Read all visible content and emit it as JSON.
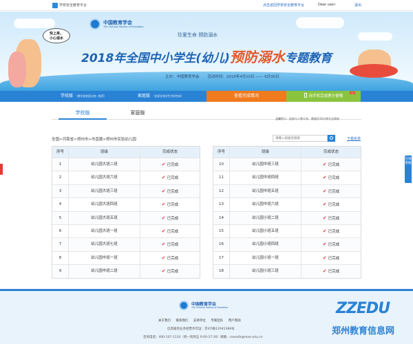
{
  "topbar": {
    "site_name": "学校安全教育平台",
    "login_link": "点击返回学校安全教育平台",
    "user": "Dear user:",
    "logout": "退出"
  },
  "banner": {
    "org_name": "中国教育学会",
    "org_en": "The Chinese Society of Education",
    "slogan": "珍爱生命    预防溺水",
    "headline_pre": "2018年全国中小学生(幼儿)",
    "headline_em": "预防溺水",
    "headline_post": "专题教育",
    "host": "主办：中国教育学会",
    "date": "活动时间：2018年4月10日 —— 6月30日",
    "bubble_line1": "快上来，",
    "bubble_line2": "小心溺水"
  },
  "nav": {
    "school": "学校版",
    "school_sub": "（教学校校园与统一推荐）",
    "family": "家庭版",
    "family_sub": "（由家长和学生共同完成）",
    "view_progress": "查看完成情况",
    "mobile": "用手机完成更方便哦",
    "new_badge": "new"
  },
  "tabs": {
    "school": "学校版",
    "family": "家庭版",
    "tip": "温馨提示：因参与人数众多，数据约30分钟左右刷新"
  },
  "breadcrumb": "全国>河南省>郑州市>市直属>郑州市实验幼儿园",
  "search": {
    "placeholder": "请输入班级名搜索",
    "download": "下载名单"
  },
  "table": {
    "col_no": "序号",
    "col_class": "班级",
    "col_status": "完成状态",
    "left_rows": [
      {
        "no": "1",
        "cls": "幼儿园大班二班",
        "status": "已完成"
      },
      {
        "no": "2",
        "cls": "幼儿园大班六班",
        "status": "已完成"
      },
      {
        "no": "3",
        "cls": "幼儿园大班三班",
        "status": "已完成"
      },
      {
        "no": "4",
        "cls": "幼儿园大班四班",
        "status": "已完成"
      },
      {
        "no": "5",
        "cls": "幼儿园大班五班",
        "status": "已完成"
      },
      {
        "no": "6",
        "cls": "幼儿园大班一班",
        "status": "已完成"
      },
      {
        "no": "7",
        "cls": "幼儿园大班七班",
        "status": "已完成"
      },
      {
        "no": "8",
        "cls": "幼儿园中班一班",
        "status": "已完成"
      },
      {
        "no": "9",
        "cls": "幼儿园中班二班",
        "status": "已完成"
      }
    ],
    "right_rows": [
      {
        "no": "10",
        "cls": "幼儿园中班三班",
        "status": "已完成"
      },
      {
        "no": "11",
        "cls": "幼儿园中班四班",
        "status": "已完成"
      },
      {
        "no": "12",
        "cls": "幼儿园中班五班",
        "status": "已完成"
      },
      {
        "no": "13",
        "cls": "幼儿园中班六班",
        "status": "已完成"
      },
      {
        "no": "14",
        "cls": "幼儿园小班二班",
        "status": "已完成"
      },
      {
        "no": "15",
        "cls": "幼儿园小班五班",
        "status": "已完成"
      },
      {
        "no": "16",
        "cls": "幼儿园小班四班",
        "status": "已完成"
      },
      {
        "no": "17",
        "cls": "幼儿园小班一班",
        "status": "已完成"
      },
      {
        "no": "18",
        "cls": "幼儿园小班三班",
        "status": "已完成"
      }
    ]
  },
  "side_float": "在线客服",
  "footer": {
    "org_name": "中国教育学会",
    "org_en": "The Chinese Society of Education",
    "links": [
      "关于我们",
      "联系我们",
      "支持单位",
      "专家团队",
      "用户帮助"
    ],
    "icp": "信息服务业务经营许可证：京ICP备12041388号",
    "contact": "咨询电话：400-107-1110（周一到周五 9:00-17:30）邮箱：csesafe@moe.edu.cn"
  },
  "watermark": {
    "top": "ZZEDU",
    "bottom": "郑州教育信息网"
  },
  "colors": {
    "primary": "#2a82d5",
    "orange": "#f07a1e",
    "green": "#8ac43f",
    "check_red": "#e53935"
  }
}
